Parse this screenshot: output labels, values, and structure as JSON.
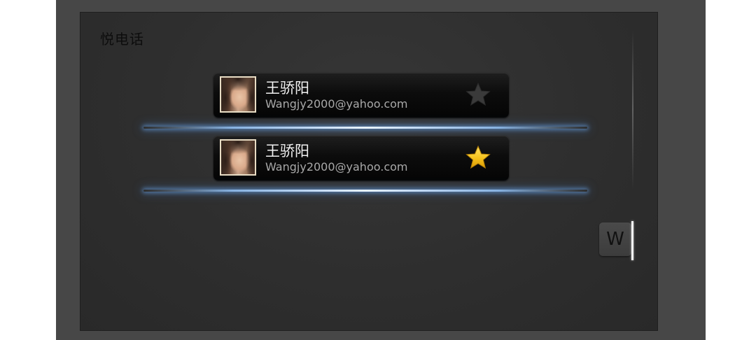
{
  "app": {
    "title": "悦电话"
  },
  "contacts": [
    {
      "name": "王骄阳",
      "email": "Wangjy2000@yahoo.com",
      "favorite": false,
      "star_icon": "star-outline-icon"
    },
    {
      "name": "王骄阳",
      "email": "Wangjy2000@yahoo.com",
      "favorite": true,
      "star_icon": "star-filled-icon"
    }
  ],
  "index": {
    "current_letter": "W"
  },
  "colors": {
    "accent_glow": "#9cc8ff",
    "star_gold": "#f6c21c",
    "star_inactive": "#3a3a3a"
  }
}
